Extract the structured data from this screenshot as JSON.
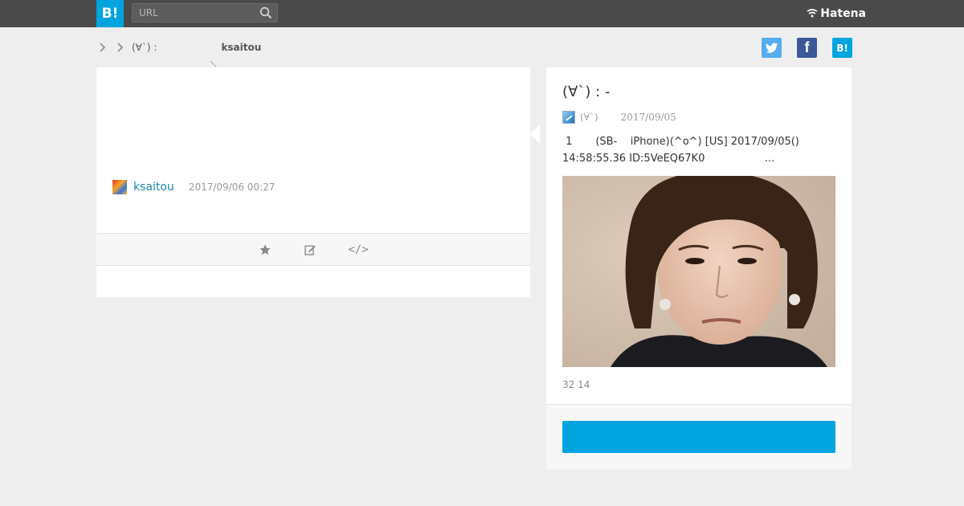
{
  "header": {
    "logo_text": "B!",
    "search_placeholder": "URL",
    "brand": "Hatena"
  },
  "breadcrumb": {
    "entry_short": "(∀`) :",
    "user": "ksaitou"
  },
  "share": {
    "twitter_icon": "twitter-icon",
    "facebook_label": "f",
    "hatena_label": "B!"
  },
  "comment": {
    "username": "ksaitou",
    "date": "2017/09/06 00:27",
    "actions": [
      "star-icon",
      "edit-icon",
      "embed-icon"
    ],
    "embed_label": "</>"
  },
  "entry": {
    "title": "(∀`) :  -",
    "site": "(∀`)",
    "date": "2017/09/05",
    "excerpt": " 1       (SB-    iPhone)(^o^) [US] 2017/09/05()\n14:58:55.36 ID:5VeEQ67K0                  ...",
    "counts": "32 14",
    "button_label": ""
  },
  "colors": {
    "accent": "#00a4de",
    "topbar": "#4a4a4a",
    "link": "#1a87b8"
  }
}
